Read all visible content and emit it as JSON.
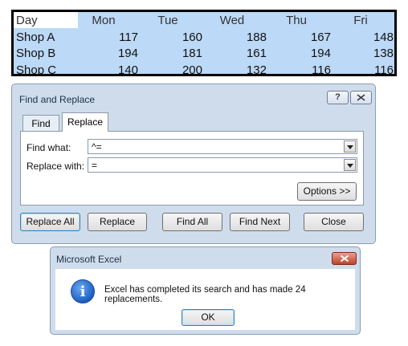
{
  "sheet": {
    "headers": [
      "Day",
      "Mon",
      "Tue",
      "Wed",
      "Thu",
      "Fri"
    ],
    "rows": [
      {
        "label": "Shop A",
        "values": [
          "117",
          "160",
          "188",
          "167",
          "148"
        ]
      },
      {
        "label": "Shop B",
        "values": [
          "194",
          "181",
          "161",
          "194",
          "138"
        ]
      },
      {
        "label": "Shop C",
        "values": [
          "140",
          "200",
          "132",
          "116",
          "116"
        ]
      }
    ]
  },
  "find_replace": {
    "title": "Find and Replace",
    "help_label": "?",
    "tabs": [
      {
        "label": "Find",
        "selected": false
      },
      {
        "label": "Replace",
        "selected": true
      }
    ],
    "find_what_label": "Find what:",
    "find_what_value": "^=",
    "replace_with_label": "Replace with:",
    "replace_with_value": "=",
    "options_label": "Options >>",
    "buttons": {
      "replace_all": "Replace All",
      "replace": "Replace",
      "find_all": "Find All",
      "find_next": "Find Next",
      "close": "Close"
    }
  },
  "message_box": {
    "title": "Microsoft Excel",
    "icon": "info-icon",
    "message": "Excel has completed its search and has made 24 replacements.",
    "ok_label": "OK"
  },
  "colors": {
    "selection_fill": "#bcd9f7",
    "dialog_background": "#cfdcec",
    "close_button_red": "#c1412a",
    "info_icon_blue": "#1c5fc2"
  }
}
